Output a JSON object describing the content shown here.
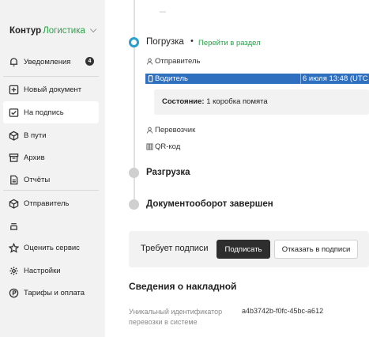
{
  "sidebar": {
    "logo": {
      "brand": "Контур",
      "product": "Логистика"
    },
    "notifications": {
      "label": "Уведомления",
      "badge": "4"
    },
    "items": [
      {
        "label": "Новый документ",
        "icon": "plus-square-icon"
      },
      {
        "label": "На подпись",
        "icon": "sign-icon",
        "active": true
      },
      {
        "label": "В пути",
        "icon": "box-icon"
      },
      {
        "label": "Архив",
        "icon": "archive-icon"
      },
      {
        "label": "Отчёты",
        "icon": "report-icon"
      }
    ],
    "role": {
      "label": "Отправитель",
      "icon": "box-icon"
    },
    "bottom": [
      {
        "label": "Оценить сервис",
        "icon": "star-icon"
      },
      {
        "label": "Настройки",
        "icon": "gear-icon"
      },
      {
        "label": "Тарифы и оплата",
        "icon": "coin-icon"
      }
    ]
  },
  "timeline": {
    "loading": {
      "title": "Погрузка",
      "link": "Перейти в раздел",
      "sender": "Отправитель",
      "driver": "Водитель",
      "driver_time": "6 июля 13:48 (UTC",
      "status_label": "Состояние:",
      "status_value": "1 коробка помята",
      "carrier": "Перевозчик",
      "qr": "QR-код"
    },
    "unloading": {
      "title": "Разгрузка"
    },
    "done": {
      "title": "Документооборот завершен"
    }
  },
  "sign_panel": {
    "requires": "Требует подписи",
    "sign_button": "Подписать",
    "refuse_button": "Отказать в подписи"
  },
  "waybill": {
    "title": "Сведения о накладной",
    "id_label": "Уникальный идентификатор перевозки в системе",
    "id_value": "a4b3742b-f0fc-45bc-a612"
  },
  "colors": {
    "accent_green": "#2ca24a",
    "active_blue": "#2a9fc9",
    "highlight": "#2f6fbf"
  }
}
